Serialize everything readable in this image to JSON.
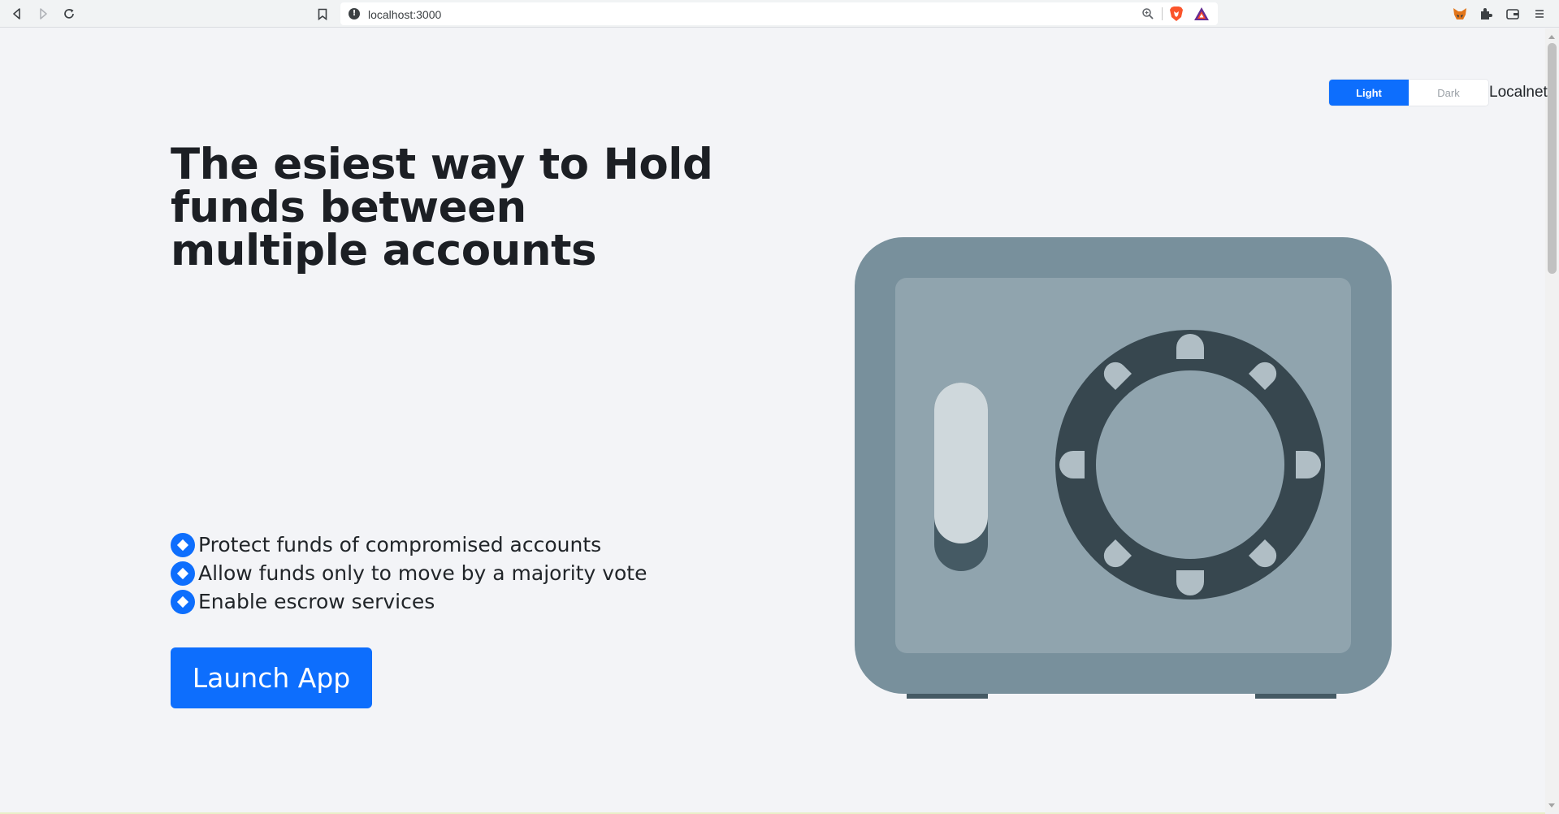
{
  "browser": {
    "url": "localhost:3000",
    "back_icon": "back-arrow-icon",
    "forward_icon": "forward-arrow-icon",
    "reload_icon": "reload-icon",
    "bookmark_icon": "bookmark-icon",
    "extensions": [
      "metamask-icon",
      "puzzle-icon",
      "wallet-icon",
      "menu-icon"
    ]
  },
  "header": {
    "theme_light": "Light",
    "theme_dark": "Dark",
    "network": "Localnet"
  },
  "hero": {
    "title": "The esiest way to Hold funds between multiple accounts",
    "features": [
      "Protect funds of compromised accounts",
      "Allow funds only to move by a majority vote",
      "Enable escrow services"
    ],
    "cta_label": "Launch App",
    "illustration": "safe-illustration"
  },
  "colors": {
    "accent": "#0d6efd",
    "background": "#f3f4f7",
    "safe_outer": "#78909c",
    "safe_inner": "#90a4ae",
    "safe_dark": "#37474f",
    "safe_light": "#cfd8dc"
  }
}
